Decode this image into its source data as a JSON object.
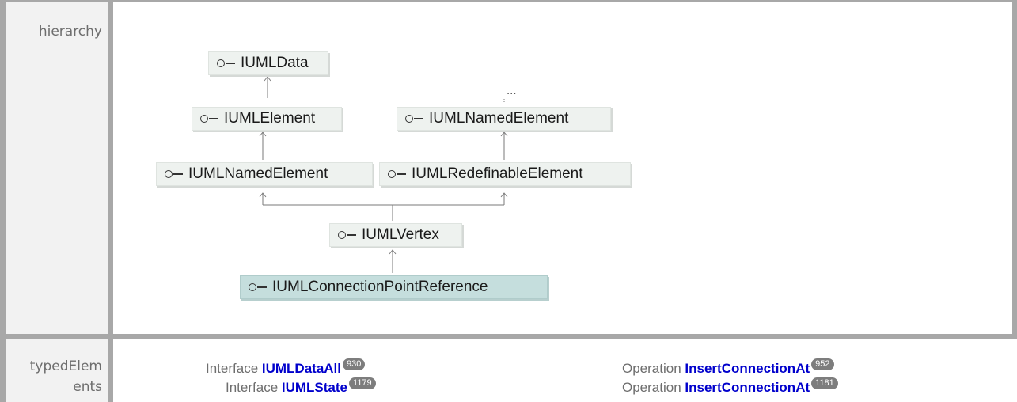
{
  "labels": {
    "hierarchy": "hierarchy",
    "typedElements_1": "typedElem",
    "typedElements_2": "ents"
  },
  "nodes": {
    "n1": "IUMLData",
    "n2": "IUMLElement",
    "n3": "IUMLNamedElement",
    "n4": "IUMLNamedElement",
    "n5": "IUMLRedefinableElement",
    "n6": "IUMLVertex",
    "n7": "IUMLConnectionPointReference",
    "more": "..."
  },
  "typed_elements": [
    {
      "kind": "Interface",
      "name": "IUMLDataAll",
      "badge": "930"
    },
    {
      "kind": "Interface",
      "name": "IUMLState",
      "badge": "1179"
    },
    {
      "kind": "Operation",
      "name": "InsertConnectionAt",
      "badge": "952"
    },
    {
      "kind": "Operation",
      "name": "InsertConnectionAt",
      "badge": "1181"
    }
  ]
}
